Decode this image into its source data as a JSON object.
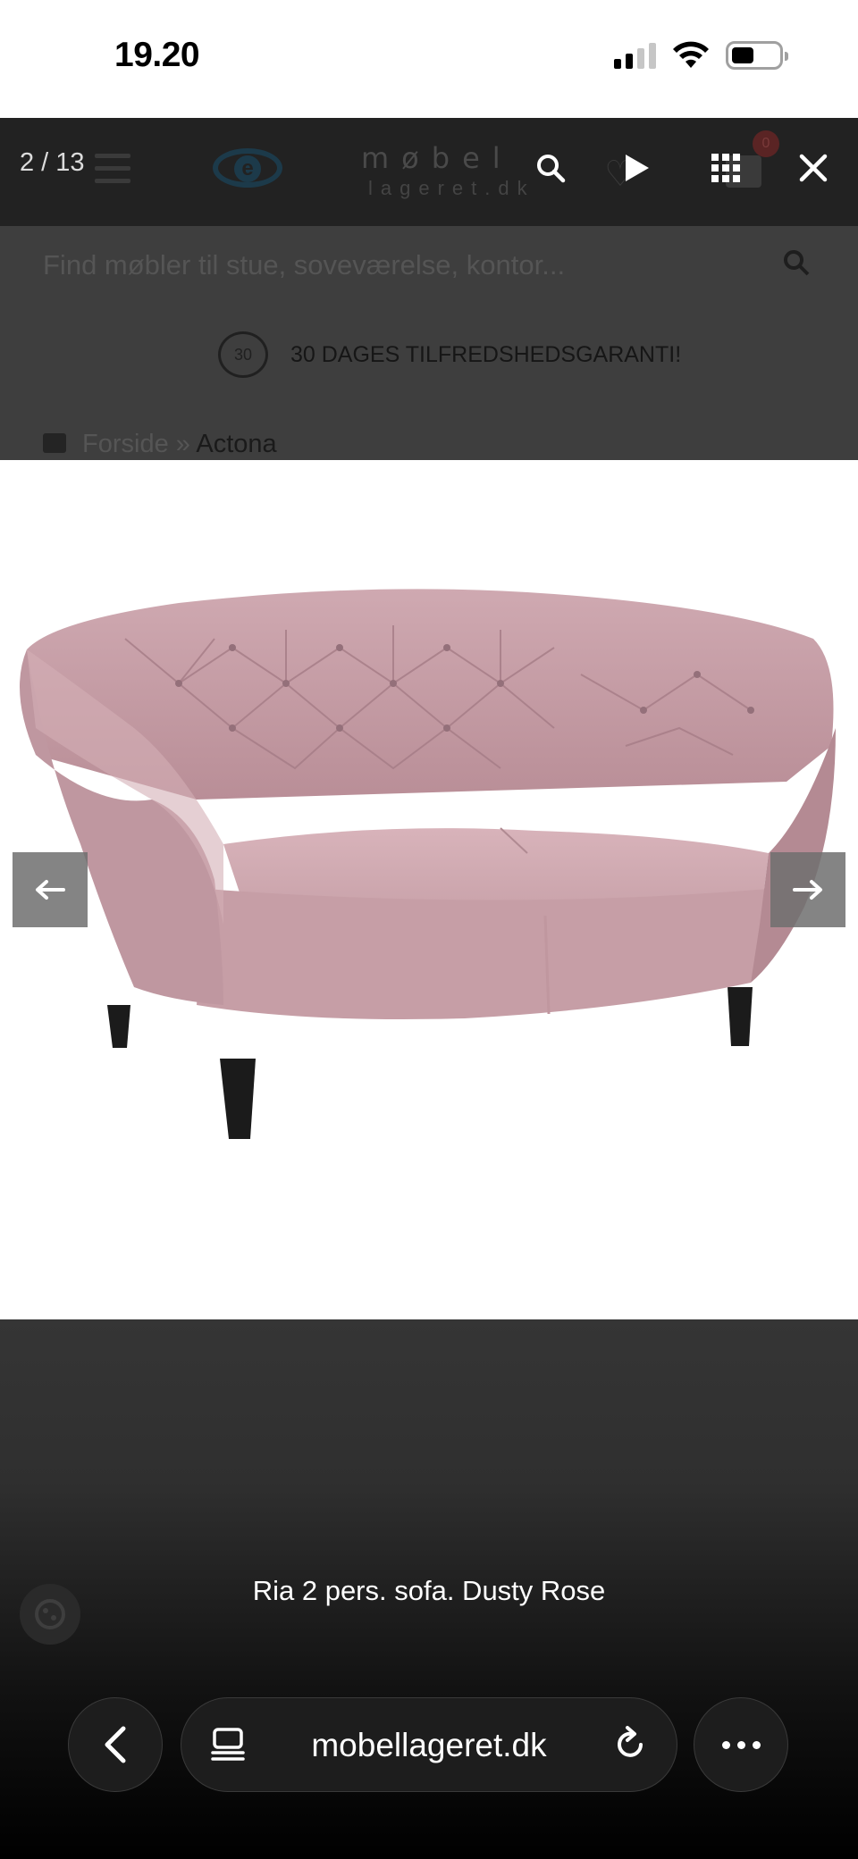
{
  "status_bar": {
    "time": "19.20",
    "icons": [
      "cellular-signal-icon",
      "wifi-icon",
      "battery-icon"
    ]
  },
  "website": {
    "logo_text": "møbel",
    "logo_subtext": "lageret.dk",
    "search_placeholder": "Find møbler til stue, soveværelse, kontor...",
    "guarantee_badge": "30",
    "guarantee_text": "30 DAGES TILFREDSHEDSGARANTI!",
    "breadcrumb": {
      "home": "Forside",
      "separator": "»",
      "current": "Actona"
    }
  },
  "lightbox": {
    "counter": "2 / 13",
    "caption": "Ria 2 pers. sofa. Dusty Rose",
    "toolbar_icons": [
      "zoom-icon",
      "play-icon",
      "thumbnails-icon",
      "close-icon"
    ],
    "arrows": [
      "arrow-left-icon",
      "arrow-right-icon"
    ],
    "colors": {
      "sofa": "#c9a3ab",
      "overlay": "#222222"
    }
  },
  "browser": {
    "url": "mobellageret.dk",
    "icons": [
      "back-icon",
      "tabs-icon",
      "reload-icon",
      "more-icon"
    ]
  }
}
